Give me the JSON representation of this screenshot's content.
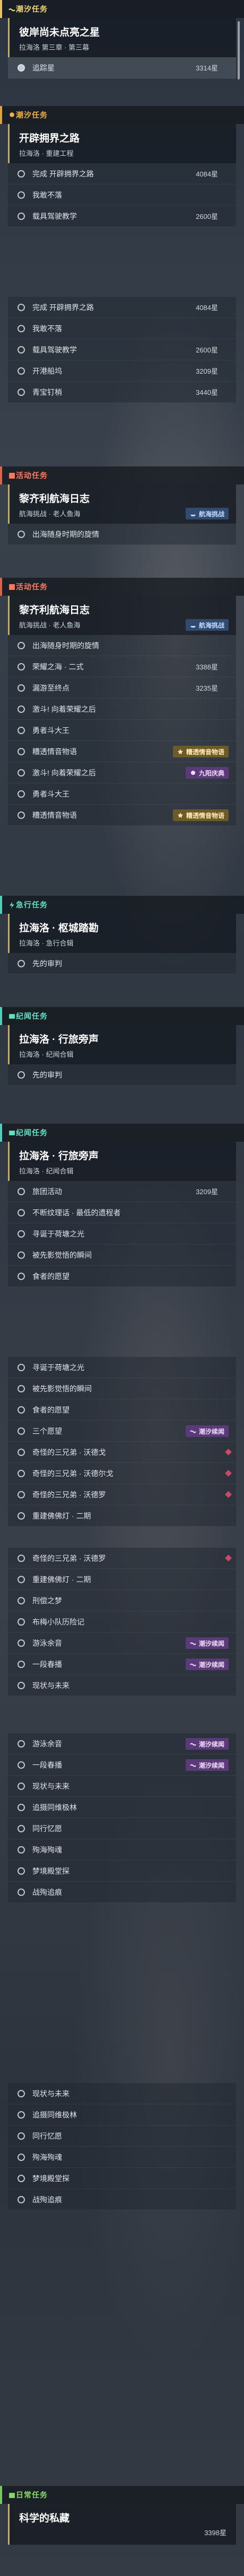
{
  "sections": {
    "chaoxi": {
      "header": "潮汐任务"
    },
    "kaiyan": {
      "header": "潮汐任务"
    },
    "event1": {
      "header": "活动任务"
    },
    "event2": {
      "header": "活动任务"
    },
    "urgent": {
      "header": "急行任务"
    },
    "jiyu": {
      "header": "纪闻任务"
    },
    "jiyu2": {
      "header": "纪闻任务"
    },
    "daily": {
      "header": "日常任务"
    }
  },
  "card1": {
    "title": "彼岸尚未点亮之星",
    "sub": "拉海洛 第三章 · 第三幕"
  },
  "card2": {
    "title": "开辟拥界之路",
    "sub": "拉海洛 · 重建工程"
  },
  "card3": {
    "title": "黎齐利航海日志",
    "sub": "航海挑战 · 老人鱼海"
  },
  "card4": {
    "title": "黎齐利航海日志",
    "sub": "航海挑战 · 老人鱼海"
  },
  "card5": {
    "title": "拉海洛 · 枢城踏勘",
    "sub": "拉海洛 · 急行合辑"
  },
  "card6": {
    "title": "拉海洛 · 行旅旁声",
    "sub": "拉海洛 · 纪闻合辑"
  },
  "card7": {
    "title": "拉海洛 · 行旅旁声",
    "sub": "拉海洛 · 纪闻合辑"
  },
  "card8": {
    "title": "科学的私藏",
    "sub": ""
  },
  "rows": [
    {
      "label": "追踪星",
      "reward": "3314星"
    },
    {
      "label": "完成 开辟拥界之路",
      "reward": "4084星"
    },
    {
      "label": "我敢不落",
      "reward": ""
    },
    {
      "label": "载具驾驶教学",
      "reward": "2600星"
    },
    {
      "label": "完成 开辟拥界之路",
      "reward": "4084星"
    },
    {
      "label": "我敢不落",
      "reward": ""
    },
    {
      "label": "载具驾驶教学",
      "reward": "2600星"
    },
    {
      "label": "开港船坞",
      "reward": "3209星"
    },
    {
      "label": "青宝钉梢",
      "reward": "3440星"
    },
    {
      "label": "出海随身时期的旋情",
      "reward": ""
    },
    {
      "label": "出海随身时期的旋情",
      "reward": ""
    },
    {
      "label": "荣耀之海 · 二式",
      "reward": "3388星"
    },
    {
      "label": "漏游至终点",
      "reward": "3235星"
    },
    {
      "label": "激斗! 向着荣耀之后",
      "reward": ""
    },
    {
      "label": "勇者斗大王",
      "reward": ""
    },
    {
      "label": "糟透情音物语",
      "reward": ""
    },
    {
      "label": "激斗! 向着荣耀之后",
      "reward": ""
    },
    {
      "label": "勇者斗大王",
      "reward": ""
    },
    {
      "label": "糟透情音物语",
      "reward": ""
    },
    {
      "label": "先的审判",
      "reward": ""
    },
    {
      "label": "先的审判",
      "reward": ""
    },
    {
      "label": "旅团活动",
      "reward": "3209星"
    },
    {
      "label": "不断纹理话 · 最低的遗程者",
      "reward": ""
    },
    {
      "label": "寻诞于荷塘之光",
      "reward": ""
    },
    {
      "label": "被先影觉悟的瞬间",
      "reward": ""
    },
    {
      "label": "食者的愿望",
      "reward": ""
    },
    {
      "label": "寻诞于荷塘之光",
      "reward": ""
    },
    {
      "label": "被先影觉悟的瞬间",
      "reward": ""
    },
    {
      "label": "食者的愿望",
      "reward": ""
    },
    {
      "label": "三个愿望",
      "reward": ""
    },
    {
      "label": "奇怪的三兄弟 · 沃德戈",
      "reward": ""
    },
    {
      "label": "奇怪的三兄弟 · 沃德尔戈",
      "reward": ""
    },
    {
      "label": "奇怪的三兄弟 · 沃德罗",
      "reward": ""
    },
    {
      "label": "重建佛佛灯 · 二期",
      "reward": ""
    },
    {
      "label": "奇怪的三兄弟 · 沃德罗",
      "reward": ""
    },
    {
      "label": "重建佛佛灯 · 二期",
      "reward": ""
    },
    {
      "label": "刑偿之梦",
      "reward": ""
    },
    {
      "label": "布梅小队历险记",
      "reward": ""
    },
    {
      "label": "游泳余音",
      "reward": ""
    },
    {
      "label": "一段春播",
      "reward": ""
    },
    {
      "label": "现状与未来",
      "reward": ""
    },
    {
      "label": "游泳余音",
      "reward": ""
    },
    {
      "label": "一段春播",
      "reward": ""
    },
    {
      "label": "现状与未来",
      "reward": ""
    },
    {
      "label": "追摄同维极林",
      "reward": ""
    },
    {
      "label": "同行忆愿",
      "reward": ""
    },
    {
      "label": "殉海殉魂",
      "reward": ""
    },
    {
      "label": "梦境殿堂探",
      "reward": ""
    },
    {
      "label": "战殉追痕",
      "reward": ""
    },
    {
      "label": "现状与未来",
      "reward": ""
    },
    {
      "label": "追摄同维极林",
      "reward": ""
    },
    {
      "label": "同行忆愿",
      "reward": ""
    },
    {
      "label": "殉海殉魂",
      "reward": ""
    },
    {
      "label": "梦境殿堂探",
      "reward": ""
    },
    {
      "label": "战殉追痕",
      "reward": ""
    }
  ],
  "tags": {
    "nav": "航海挑战",
    "limit": "糟透情音物语",
    "chaoxi": "潮汐续闻",
    "nine": "九阳庆典"
  },
  "daily_reward": "3398星",
  "colors": {
    "gold": "#e7c25d",
    "red": "#e0614a",
    "teal": "#4fd1b7",
    "purple": "#5a3a78"
  }
}
